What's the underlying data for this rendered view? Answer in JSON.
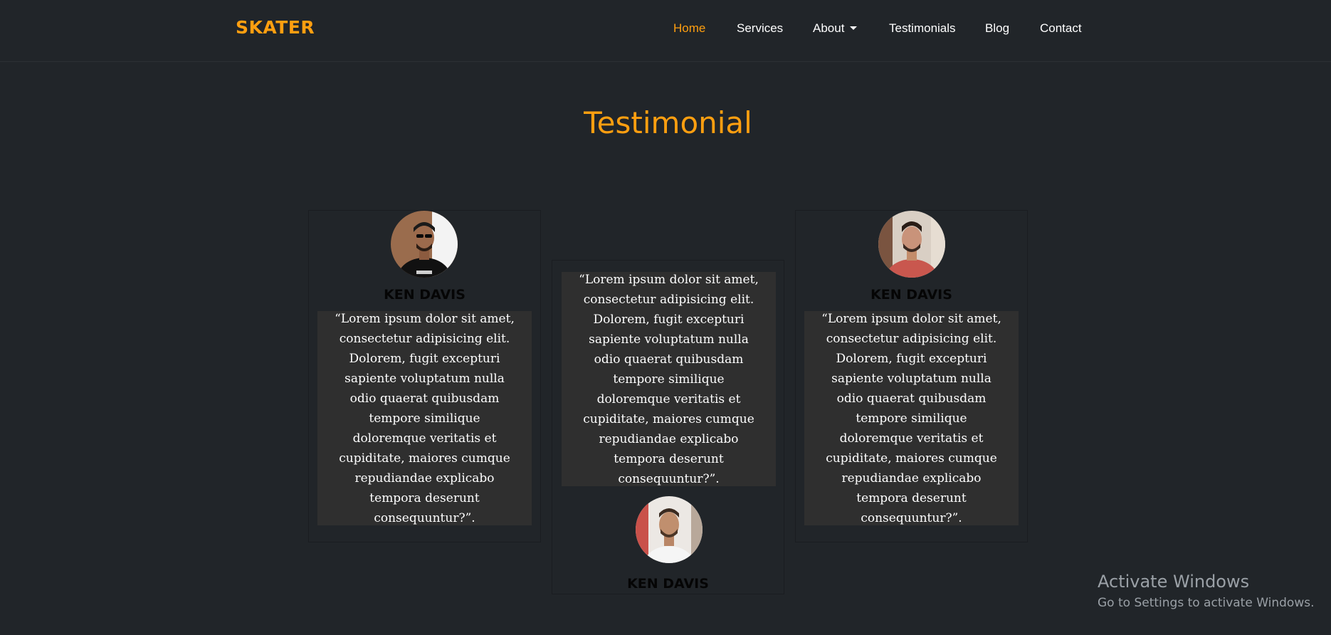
{
  "navbar": {
    "brand": "SKATER",
    "links": [
      {
        "label": "Home",
        "active": true
      },
      {
        "label": "Services"
      },
      {
        "label": "About"
      },
      {
        "label": "Testimonials"
      },
      {
        "label": "Blog"
      },
      {
        "label": "Contact"
      }
    ],
    "accent_color": "#ff9f10"
  },
  "section": {
    "title": "Testimonial"
  },
  "testimonials": [
    {
      "name": "KEN DAVIS",
      "quote": "“Lorem ipsum dolor sit amet, consectetur adipisicing elit. Dolorem, fugit excepturi sapiente voluptatum nulla odio quaerat quibusdam tempore similique doloremque veritatis et cupiditate, maiores cumque repudiandae explicabo tempora deserunt consequuntur?”.",
      "avatar": "avatar-photo-sunglasses"
    },
    {
      "name": "KEN DAVIS",
      "quote": "“Lorem ipsum dolor sit amet, consectetur adipisicing elit. Dolorem, fugit excepturi sapiente voluptatum nulla odio quaerat quibusdam tempore similique doloremque veritatis et cupiditate, maiores cumque repudiandae explicabo tempora deserunt consequuntur?”.",
      "avatar": "avatar-photo-white-shirt"
    },
    {
      "name": "KEN DAVIS",
      "quote": "“Lorem ipsum dolor sit amet, consectetur adipisicing elit. Dolorem, fugit excepturi sapiente voluptatum nulla odio quaerat quibusdam tempore similique doloremque veritatis et cupiditate, maiores cumque repudiandae explicabo tempora deserunt consequuntur?”.",
      "avatar": "avatar-photo-red-shirt"
    }
  ],
  "watermark": {
    "title": "Activate Windows",
    "subtitle": "Go to Settings to activate Windows."
  }
}
